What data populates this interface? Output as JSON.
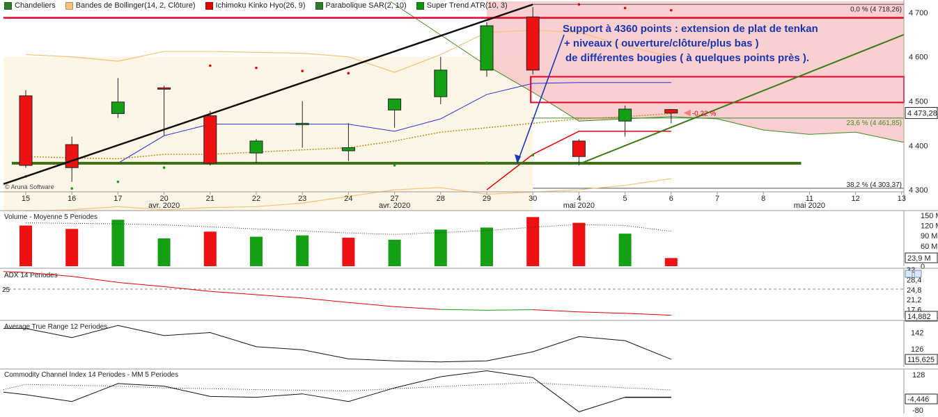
{
  "legend": [
    {
      "label": "Chandeliers",
      "color": "#2e7d2e"
    },
    {
      "label": "Bandes de Bollinger(14, 2, Clôture)",
      "color": "#f4c27a"
    },
    {
      "label": "Ichimoku Kinko Hyo(26, 9)",
      "color": "#e00000"
    },
    {
      "label": "Parabolique SAR(2, 10)",
      "color": "#2e7d2e"
    },
    {
      "label": "Super Trend ATR(10, 3)",
      "color": "#109010"
    }
  ],
  "annotation": {
    "line1": "Support à 4360 points : extension de plat de tenkan",
    "line2": "+ niveaux ( ouverture/clôture/plus bas )",
    "line3": "de différentes bougies ( à quelques points près )."
  },
  "chart_data": {
    "type": "candlestick",
    "x_ticks": [
      "15",
      "16",
      "17",
      "20",
      "21",
      "22",
      "23",
      "24",
      "27",
      "28",
      "29",
      "30",
      "4",
      "5",
      "6",
      "7",
      "8",
      "11",
      "12",
      "13"
    ],
    "month_labels": [
      {
        "text": "avr. 2020",
        "at": "20"
      },
      {
        "text": "avr. 2020",
        "at": "27"
      },
      {
        "text": "mai 2020",
        "at": "4"
      },
      {
        "text": "mai 2020",
        "at": "11"
      }
    ],
    "price_axis": {
      "ticks": [
        4300,
        4400,
        4500,
        4600,
        4700
      ],
      "labels": [
        "4 300",
        "4 400",
        "4 500",
        "4 600",
        "4 700"
      ],
      "ylim": [
        4297,
        4725
      ]
    },
    "candles": [
      {
        "date": "15",
        "open": 4512,
        "high": 4525,
        "low": 4350,
        "close": 4355
      },
      {
        "date": "16",
        "open": 4402,
        "high": 4420,
        "low": 4318,
        "close": 4350
      },
      {
        "date": "17",
        "open": 4472,
        "high": 4552,
        "low": 4462,
        "close": 4498
      },
      {
        "date": "20",
        "open": 4530,
        "high": 4535,
        "low": 4423,
        "close": 4528
      },
      {
        "date": "21",
        "open": 4467,
        "high": 4478,
        "low": 4355,
        "close": 4360
      },
      {
        "date": "22",
        "open": 4383,
        "high": 4415,
        "low": 4360,
        "close": 4410
      },
      {
        "date": "23",
        "open": 4448,
        "high": 4500,
        "low": 4395,
        "close": 4450
      },
      {
        "date": "24",
        "open": 4388,
        "high": 4450,
        "low": 4365,
        "close": 4395
      },
      {
        "date": "27",
        "open": 4480,
        "high": 4505,
        "low": 4440,
        "close": 4505
      },
      {
        "date": "28",
        "open": 4510,
        "high": 4600,
        "low": 4493,
        "close": 4570
      },
      {
        "date": "29",
        "open": 4570,
        "high": 4678,
        "low": 4555,
        "close": 4670
      },
      {
        "date": "30",
        "open": 4690,
        "high": 4712,
        "low": 4560,
        "close": 4570
      },
      {
        "date": "4",
        "open": 4410,
        "high": 4414,
        "low": 4355,
        "close": 4375
      },
      {
        "date": "5",
        "open": 4455,
        "high": 4490,
        "low": 4420,
        "close": 4482
      },
      {
        "date": "6",
        "open": 4481,
        "high": 4482,
        "low": 4450,
        "close": 4473
      }
    ],
    "parabolic_sar": [
      {
        "date": "15",
        "value": 4330
      },
      {
        "date": "16",
        "value": 4303
      },
      {
        "date": "17",
        "value": 4318
      },
      {
        "date": "20",
        "value": 4350
      },
      {
        "date": "21",
        "value": 4580
      },
      {
        "date": "22",
        "value": 4575
      },
      {
        "date": "23",
        "value": 4568
      },
      {
        "date": "24",
        "value": 4563
      },
      {
        "date": "27",
        "value": 4355
      },
      {
        "date": "29",
        "value": 4361
      },
      {
        "date": "30",
        "value": 4378
      },
      {
        "date": "4",
        "value": 4718
      },
      {
        "date": "5",
        "value": 4710
      },
      {
        "date": "6",
        "value": 4705
      }
    ],
    "bollinger_upper": [
      {
        "date": "15",
        "value": 4605
      },
      {
        "date": "16",
        "value": 4600
      },
      {
        "date": "17",
        "value": 4590
      },
      {
        "date": "20",
        "value": 4612
      },
      {
        "date": "21",
        "value": 4612
      },
      {
        "date": "22",
        "value": 4610
      },
      {
        "date": "23",
        "value": 4608
      },
      {
        "date": "24",
        "value": 4600
      },
      {
        "date": "27",
        "value": 4565
      },
      {
        "date": "28",
        "value": 4605
      },
      {
        "date": "29",
        "value": 4655
      },
      {
        "date": "30",
        "value": 4660
      },
      {
        "date": "4",
        "value": 4655
      },
      {
        "date": "5",
        "value": 4625
      },
      {
        "date": "6",
        "value": 4600
      }
    ],
    "bollinger_lower": [
      {
        "date": "15",
        "value": 4252
      },
      {
        "date": "16",
        "value": 4255
      },
      {
        "date": "17",
        "value": 4262
      },
      {
        "date": "20",
        "value": 4255
      },
      {
        "date": "21",
        "value": 4260
      },
      {
        "date": "22",
        "value": 4262
      },
      {
        "date": "23",
        "value": 4270
      },
      {
        "date": "24",
        "value": 4285
      },
      {
        "date": "27",
        "value": 4300
      },
      {
        "date": "28",
        "value": 4305
      },
      {
        "date": "29",
        "value": 4290
      },
      {
        "date": "30",
        "value": 4295
      },
      {
        "date": "4",
        "value": 4300
      },
      {
        "date": "5",
        "value": 4310
      },
      {
        "date": "6",
        "value": 4325
      }
    ],
    "bollinger_middle": [
      {
        "date": "15",
        "value": 4375
      },
      {
        "date": "16",
        "value": 4372
      },
      {
        "date": "17",
        "value": 4370
      },
      {
        "date": "20",
        "value": 4380
      },
      {
        "date": "21",
        "value": 4380
      },
      {
        "date": "22",
        "value": 4385
      },
      {
        "date": "23",
        "value": 4390
      },
      {
        "date": "24",
        "value": 4395
      },
      {
        "date": "27",
        "value": 4410
      },
      {
        "date": "28",
        "value": 4430
      },
      {
        "date": "29",
        "value": 4440
      },
      {
        "date": "30",
        "value": 4450
      },
      {
        "date": "4",
        "value": 4460
      },
      {
        "date": "5",
        "value": 4465
      },
      {
        "date": "6",
        "value": 4472
      }
    ],
    "tenkan": [
      {
        "date": "16",
        "value": 4360
      },
      {
        "date": "17",
        "value": 4360
      },
      {
        "date": "20",
        "value": 4422
      },
      {
        "date": "21",
        "value": 4448
      },
      {
        "date": "22",
        "value": 4448
      },
      {
        "date": "23",
        "value": 4448
      },
      {
        "date": "24",
        "value": 4448
      },
      {
        "date": "27",
        "value": 4432
      },
      {
        "date": "28",
        "value": 4460
      },
      {
        "date": "29",
        "value": 4515
      },
      {
        "date": "30",
        "value": 4540
      },
      {
        "date": "4",
        "value": 4542
      },
      {
        "date": "5",
        "value": 4542
      },
      {
        "date": "6",
        "value": 4542
      }
    ],
    "super_trend": [
      {
        "date": "29",
        "value": 4300
      },
      {
        "date": "30",
        "value": 4380
      },
      {
        "date": "4",
        "value": 4432
      },
      {
        "date": "5",
        "value": 4432
      },
      {
        "date": "6",
        "value": 4432
      }
    ],
    "kumo_upper": [
      {
        "date": "29",
        "value": 4725
      },
      {
        "date": "30",
        "value": 4725
      },
      {
        "date": "4",
        "value": 4725
      },
      {
        "date": "5",
        "value": 4725
      },
      {
        "date": "6",
        "value": 4725
      },
      {
        "date": "7",
        "value": 4725
      },
      {
        "date": "8",
        "value": 4725
      },
      {
        "date": "11",
        "value": 4725
      },
      {
        "date": "12",
        "value": 4725
      },
      {
        "date": "13",
        "value": 4725
      }
    ],
    "kumo_lower": [
      {
        "date": "29",
        "value": 4580
      },
      {
        "date": "30",
        "value": 4520
      },
      {
        "date": "4",
        "value": 4455
      },
      {
        "date": "5",
        "value": 4460
      },
      {
        "date": "6",
        "value": 4465
      },
      {
        "date": "7",
        "value": 4460
      },
      {
        "date": "8",
        "value": 4435
      },
      {
        "date": "11",
        "value": 4425
      },
      {
        "date": "12",
        "value": 4430
      },
      {
        "date": "13",
        "value": 4408
      }
    ],
    "drawn_lines": {
      "trendline_black": {
        "from": {
          "date": "15",
          "value": 4313
        },
        "to": {
          "date": "30",
          "value": 4718
        }
      },
      "trendline_green": {
        "from": {
          "date": "4",
          "value": 4358
        },
        "to": {
          "date": "13",
          "value": 4650
        }
      },
      "support": {
        "value": 4360,
        "from": "15",
        "to": "10"
      },
      "resistance": {
        "value": 4688
      },
      "resistance_zone": {
        "from_value": 4497,
        "to_value": 4555
      }
    },
    "fib_levels": [
      {
        "label": "0,0 % (4 718,26)",
        "value": 4718.26
      },
      {
        "label": "23,6 % (4 461,85)",
        "value": 4461.85
      },
      {
        "label": "38,2 % (4 303,37)",
        "value": 4303.37
      }
    ],
    "last_price": {
      "label": "4 473,28",
      "value": 4473.28
    },
    "change_label": "-0,22 %",
    "watermark": "© Aruna Software",
    "volume": {
      "title": "Volume  - Moyenne 5 Periodes",
      "ticks": [
        "150 M",
        "120 M",
        "90 M",
        "60 M",
        "30 M",
        "0"
      ],
      "last_label": "23,9 M",
      "values": [
        {
          "date": "15",
          "value": 120,
          "up": false
        },
        {
          "date": "16",
          "value": 110,
          "up": false
        },
        {
          "date": "17",
          "value": 137,
          "up": true
        },
        {
          "date": "20",
          "value": 82,
          "up": true
        },
        {
          "date": "21",
          "value": 102,
          "up": false
        },
        {
          "date": "22",
          "value": 87,
          "up": true
        },
        {
          "date": "23",
          "value": 91,
          "up": true
        },
        {
          "date": "24",
          "value": 84,
          "up": false
        },
        {
          "date": "27",
          "value": 78,
          "up": true
        },
        {
          "date": "28",
          "value": 108,
          "up": true
        },
        {
          "date": "29",
          "value": 114,
          "up": true
        },
        {
          "date": "30",
          "value": 145,
          "up": false
        },
        {
          "date": "4",
          "value": 128,
          "up": false
        },
        {
          "date": "5",
          "value": 96,
          "up": true
        },
        {
          "date": "6",
          "value": 24,
          "up": false
        }
      ],
      "average": [
        {
          "date": "15",
          "value": 128
        },
        {
          "date": "17",
          "value": 125
        },
        {
          "date": "20",
          "value": 122
        },
        {
          "date": "22",
          "value": 110
        },
        {
          "date": "24",
          "value": 98
        },
        {
          "date": "27",
          "value": 94
        },
        {
          "date": "28",
          "value": 99
        },
        {
          "date": "29",
          "value": 105
        },
        {
          "date": "30",
          "value": 115
        },
        {
          "date": "4",
          "value": 123
        },
        {
          "date": "5",
          "value": 120
        },
        {
          "date": "6",
          "value": 103
        }
      ]
    },
    "adx": {
      "title": "ADX 14 Periodes",
      "ticks": [
        "32",
        "28,4",
        "24,8",
        "21,2",
        "17,6"
      ],
      "ref_label": "25",
      "last_label": "14,882",
      "values": [
        {
          "date": "15",
          "value": 31
        },
        {
          "date": "16",
          "value": 29.6
        },
        {
          "date": "17",
          "value": 27.4
        },
        {
          "date": "20",
          "value": 25.9
        },
        {
          "date": "21",
          "value": 24.2
        },
        {
          "date": "22",
          "value": 23.0
        },
        {
          "date": "23",
          "value": 21.8
        },
        {
          "date": "24",
          "value": 20.2
        },
        {
          "date": "27",
          "value": 18.7
        },
        {
          "date": "28",
          "value": 17.7
        },
        {
          "date": "29",
          "value": 17.4
        },
        {
          "date": "30",
          "value": 17.6
        },
        {
          "date": "4",
          "value": 16.8
        },
        {
          "date": "5",
          "value": 16.3
        },
        {
          "date": "6",
          "value": 15.6
        }
      ]
    },
    "atr": {
      "title": "Average True Range 12 Periodes",
      "ticks": [
        "142",
        "126"
      ],
      "last_label": "115,625",
      "values": [
        {
          "date": "15",
          "value": 146
        },
        {
          "date": "16",
          "value": 137
        },
        {
          "date": "17",
          "value": 149
        },
        {
          "date": "20",
          "value": 139
        },
        {
          "date": "21",
          "value": 142
        },
        {
          "date": "22",
          "value": 128
        },
        {
          "date": "23",
          "value": 125
        },
        {
          "date": "24",
          "value": 116
        },
        {
          "date": "27",
          "value": 114
        },
        {
          "date": "28",
          "value": 113
        },
        {
          "date": "29",
          "value": 114
        },
        {
          "date": "30",
          "value": 123
        },
        {
          "date": "4",
          "value": 138
        },
        {
          "date": "5",
          "value": 134
        },
        {
          "date": "6",
          "value": 115.6
        }
      ]
    },
    "cci": {
      "title": "Commodity Channel Index 14 Periodes - MM  5 Periodes",
      "ticks": [
        "128",
        "-80"
      ],
      "last_label": "-4,446",
      "values": [
        {
          "date": "15",
          "value": 10
        },
        {
          "date": "16",
          "value": -30
        },
        {
          "date": "17",
          "value": 75
        },
        {
          "date": "20",
          "value": 60
        },
        {
          "date": "21",
          "value": 0
        },
        {
          "date": "22",
          "value": -5
        },
        {
          "date": "23",
          "value": 15
        },
        {
          "date": "24",
          "value": -30
        },
        {
          "date": "27",
          "value": 50
        },
        {
          "date": "28",
          "value": 115
        },
        {
          "date": "29",
          "value": 150
        },
        {
          "date": "30",
          "value": 110
        },
        {
          "date": "4",
          "value": -90
        },
        {
          "date": "5",
          "value": -5
        },
        {
          "date": "6",
          "value": -5
        }
      ],
      "ma": [
        {
          "date": "15",
          "value": 70
        },
        {
          "date": "17",
          "value": 60
        },
        {
          "date": "20",
          "value": 50
        },
        {
          "date": "22",
          "value": 40
        },
        {
          "date": "24",
          "value": 32
        },
        {
          "date": "27",
          "value": 45
        },
        {
          "date": "29",
          "value": 70
        },
        {
          "date": "30",
          "value": 80
        },
        {
          "date": "4",
          "value": 65
        },
        {
          "date": "5",
          "value": 50
        },
        {
          "date": "6",
          "value": 38
        }
      ]
    }
  }
}
